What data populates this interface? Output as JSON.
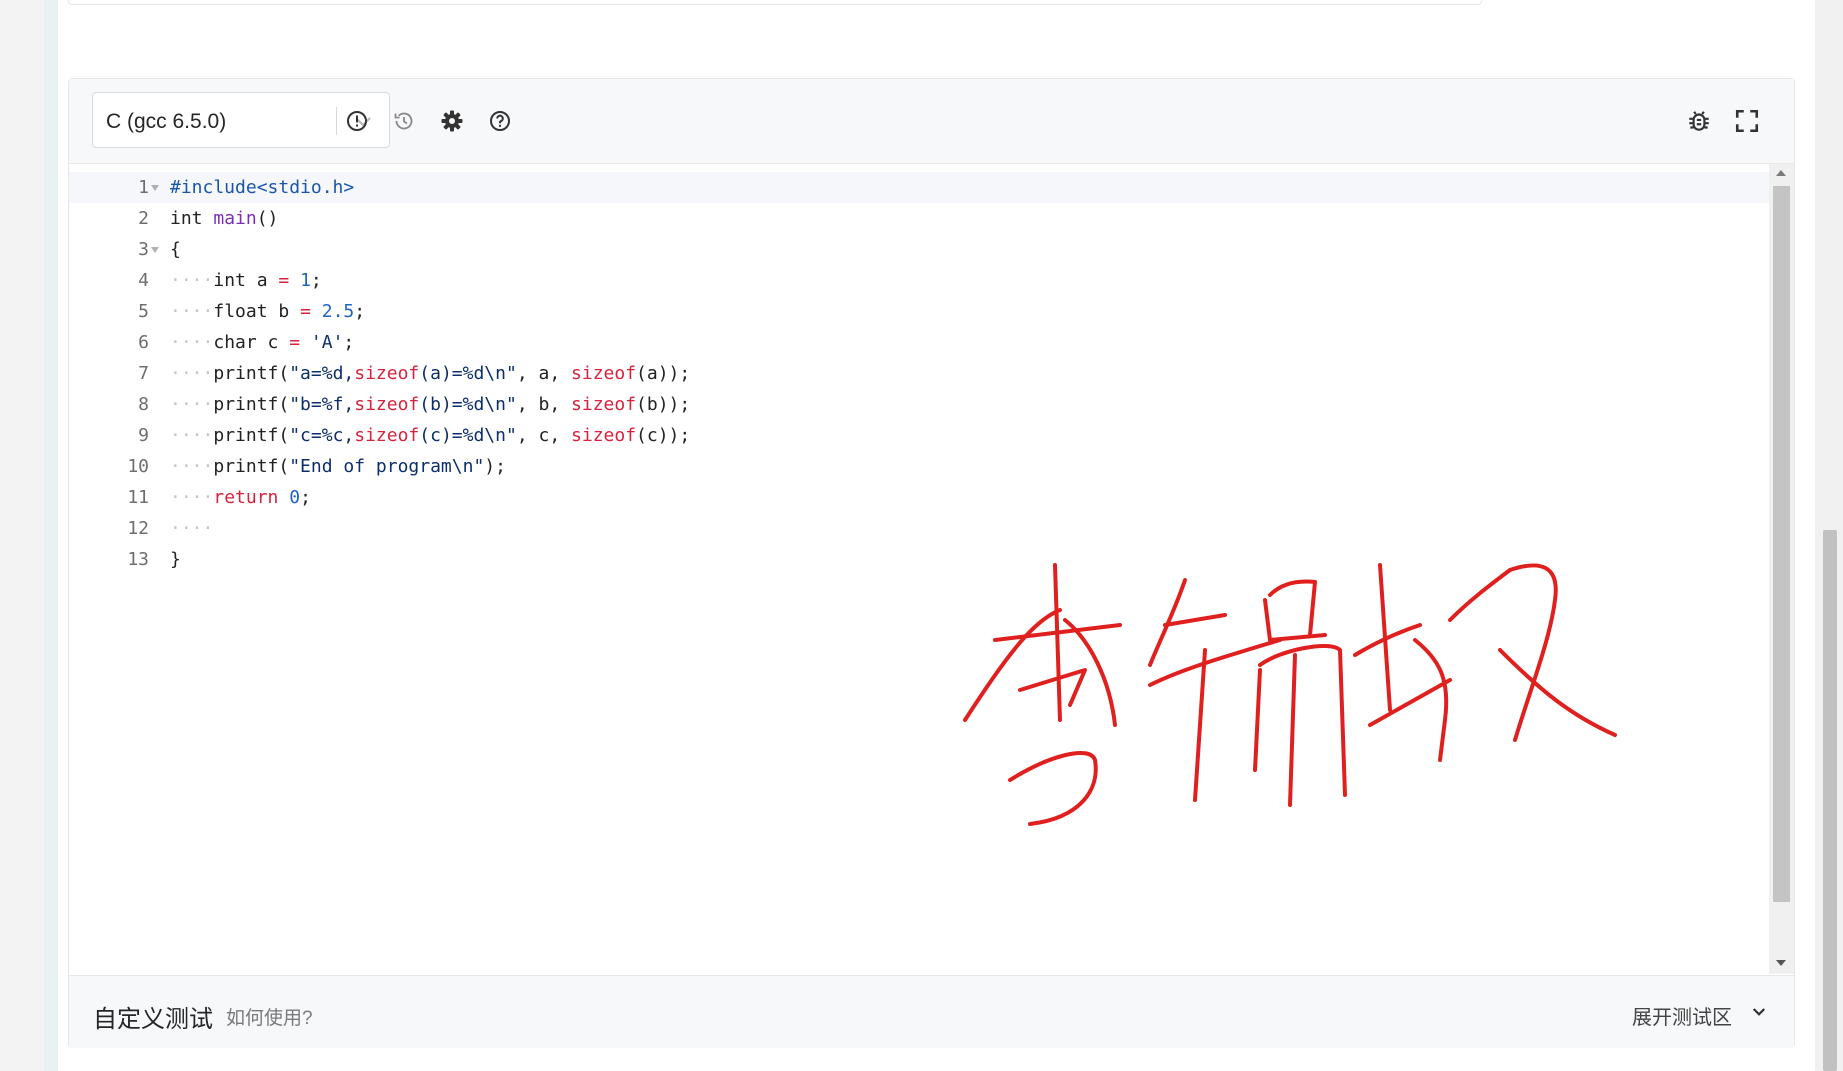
{
  "toolbar": {
    "language_value": "C (gcc 6.5.0)",
    "icons": [
      "alert-circle-icon",
      "history-icon",
      "gear-icon",
      "question-circle-icon",
      "bug-icon",
      "fullscreen-icon"
    ]
  },
  "editor": {
    "line_numbers": [
      "1",
      "2",
      "3",
      "4",
      "5",
      "6",
      "7",
      "8",
      "9",
      "10",
      "11",
      "12",
      "13"
    ],
    "code_lines": [
      "#include<stdio.h>",
      "int main()",
      "{",
      "    int a = 1;",
      "    float b = 2.5;",
      "    char c = 'A';",
      "    printf(\"a=%d,sizeof(a)=%d\\n\", a, sizeof(a));",
      "    printf(\"b=%f,sizeof(b)=%d\\n\", b, sizeof(b));",
      "    printf(\"c=%c,sizeof(c)=%d\\n\", c, sizeof(c));",
      "    printf(\"End of program\\n\");",
      "    return 0;",
      "    ",
      "}"
    ]
  },
  "footer": {
    "title": "自定义测试",
    "help_link": "如何使用?",
    "expand_label": "展开测试区"
  },
  "handwriting": {
    "text": "李锦轩",
    "color": "#e0201e"
  }
}
